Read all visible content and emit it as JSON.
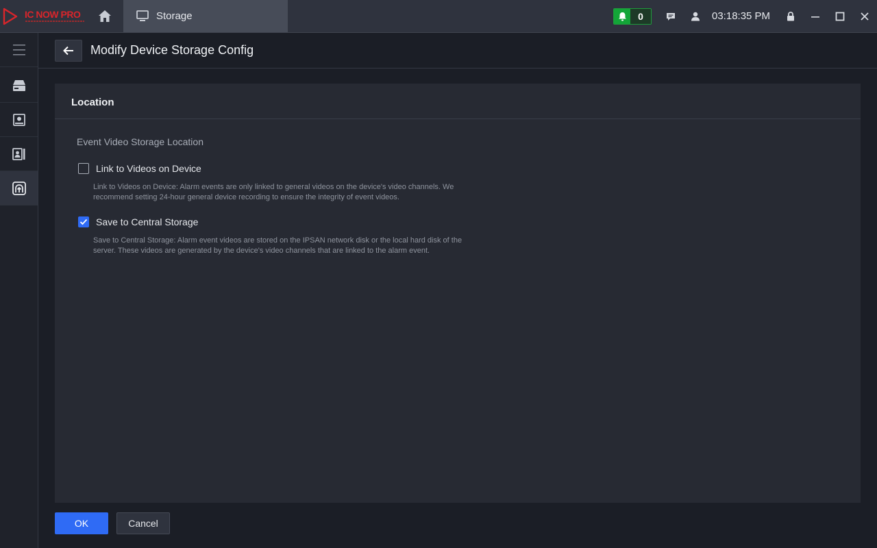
{
  "app": {
    "brand": "IC NOW PRO",
    "logo_icon": "play-triangle-logo",
    "accent_color": "#2f6bf5",
    "brand_color": "#d9252b"
  },
  "titlebar": {
    "home_icon": "home-icon",
    "active_tab": {
      "icon": "monitor-icon",
      "label": "Storage"
    },
    "alarm": {
      "icon": "bell-icon",
      "count": "0",
      "color": "#13a538"
    },
    "message_icon": "message-icon",
    "user_icon": "user-icon",
    "clock": "03:18:35 PM",
    "window_controls": [
      "lock-icon",
      "minimize-icon",
      "maximize-icon",
      "close-icon"
    ]
  },
  "leftnav": {
    "items": [
      {
        "icon": "menu-icon",
        "active": false
      },
      {
        "icon": "storage-device-icon",
        "active": false
      },
      {
        "icon": "disk-icon",
        "active": false
      },
      {
        "icon": "video-channel-icon",
        "active": false
      },
      {
        "icon": "upload-storage-icon",
        "active": true
      }
    ]
  },
  "page": {
    "title": "Modify Device Storage Config",
    "back_icon": "arrow-left-icon"
  },
  "panel": {
    "title": "Location",
    "section_label": "Event Video Storage Location",
    "options": [
      {
        "label": "Link to Videos on Device",
        "checked": false,
        "hint_line1": "Link to Videos on Device: Alarm events are only linked to general videos on the device's video channels. We",
        "hint_line2": "recommend setting 24-hour general device recording to ensure the integrity of event videos."
      },
      {
        "label": "Save to Central Storage",
        "checked": true,
        "hint_line1": "Save to Central Storage: Alarm event videos are stored on the IPSAN network disk or the local hard disk of the",
        "hint_line2": "server. These videos are generated by the device's video channels that are linked to the alarm event."
      }
    ]
  },
  "footer": {
    "ok_label": "OK",
    "cancel_label": "Cancel"
  }
}
